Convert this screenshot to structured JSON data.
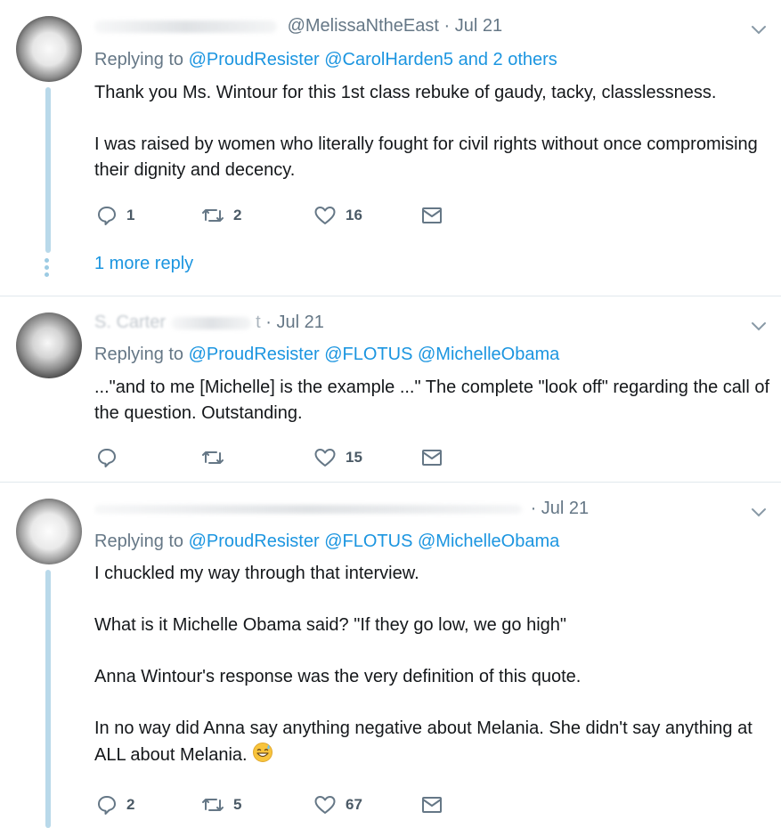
{
  "tweets": [
    {
      "handle": "@MelissaNtheEast",
      "separator": "·",
      "date": "Jul 21",
      "replying_prefix": "Replying to",
      "replying_mentions": [
        "@ProudResister",
        "@CarolHarden5"
      ],
      "replying_suffix": "and 2 others",
      "paragraphs": [
        "Thank you Ms. Wintour for this 1st class rebuke of gaudy, tacky, classlessness.",
        "I was raised by women who literally fought for civil rights without once compromising their dignity and decency."
      ],
      "replies": "1",
      "retweets": "2",
      "likes": "16",
      "more_reply": "1 more reply"
    },
    {
      "handle_partial": "S. Carter",
      "handle_tail": "t",
      "separator": "·",
      "date": "Jul 21",
      "replying_prefix": "Replying to",
      "replying_mentions": [
        "@ProudResister",
        "@FLOTUS",
        "@MichelleObama"
      ],
      "paragraphs": [
        "...\"and to me [Michelle] is the example ...\" The complete \"look off\" regarding the call of the question. Outstanding."
      ],
      "replies": "",
      "retweets": "",
      "likes": "15"
    },
    {
      "separator": "·",
      "date": "Jul 21",
      "replying_prefix": "Replying to",
      "replying_mentions": [
        "@ProudResister",
        "@FLOTUS",
        "@MichelleObama"
      ],
      "paragraphs": [
        "I chuckled my way through that interview.",
        "What is it Michelle Obama said? \"If they go low, we go high\"",
        "Anna Wintour's response was the very definition of this quote.",
        "In no way did Anna say anything negative about Melania. She didn't say anything at ALL about Melania."
      ],
      "emoji_icon": "grinning-sweat-emoji",
      "replies": "2",
      "retweets": "5",
      "likes": "67"
    }
  ],
  "icons": {
    "reply": "reply-icon",
    "retweet": "retweet-icon",
    "like": "heart-icon",
    "dm": "envelope-icon",
    "caret": "chevron-down-icon"
  },
  "colors": {
    "link": "#1b95e0",
    "muted": "#657786",
    "thread": "#b9d9ea",
    "divider": "#e1e8ed"
  }
}
